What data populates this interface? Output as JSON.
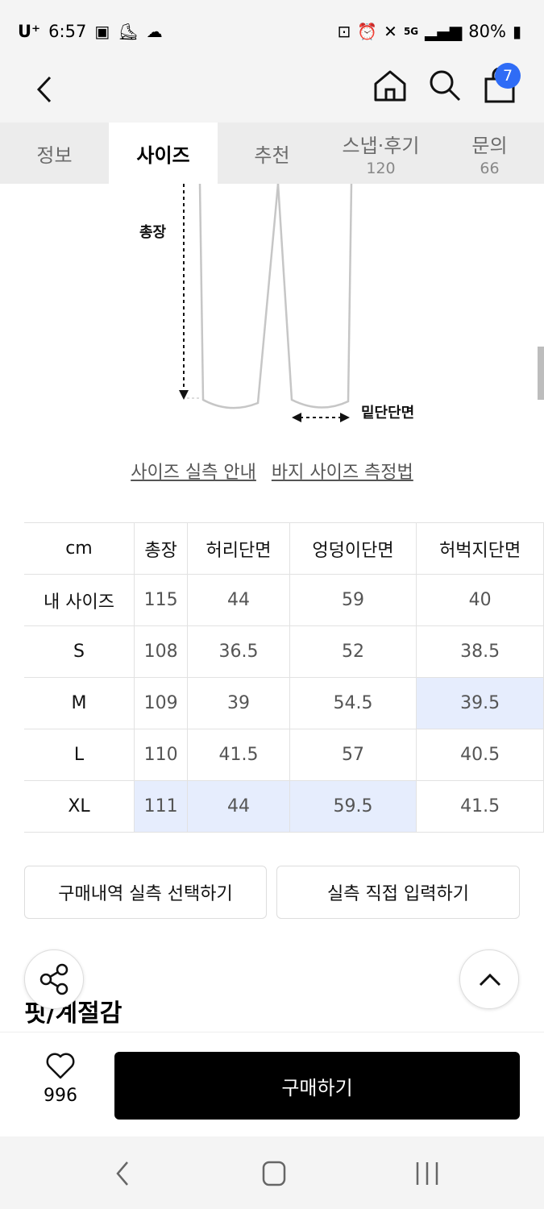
{
  "status": {
    "carrier": "U⁺",
    "time": "6:57",
    "battery": "80%",
    "network": "5G"
  },
  "header": {
    "cart_count": "7"
  },
  "tabs": [
    {
      "label": "정보",
      "count": ""
    },
    {
      "label": "사이즈",
      "count": ""
    },
    {
      "label": "추천",
      "count": ""
    },
    {
      "label": "스냅·후기",
      "count": "120"
    },
    {
      "label": "문의",
      "count": "66"
    }
  ],
  "diagram": {
    "label_length": "총장",
    "label_hem": "밑단단면"
  },
  "links": {
    "guide": "사이즈 실측 안내",
    "measure": "바지 사이즈 측정법"
  },
  "size_table": {
    "headers": [
      "cm",
      "총장",
      "허리단면",
      "엉덩이단면",
      "허벅지단면"
    ],
    "rows": [
      {
        "label": "내 사이즈",
        "values": [
          "115",
          "44",
          "59",
          "40"
        ]
      },
      {
        "label": "S",
        "values": [
          "108",
          "36.5",
          "52",
          "38.5"
        ]
      },
      {
        "label": "M",
        "values": [
          "109",
          "39",
          "54.5",
          "39.5"
        ]
      },
      {
        "label": "L",
        "values": [
          "110",
          "41.5",
          "57",
          "40.5"
        ]
      },
      {
        "label": "XL",
        "values": [
          "111",
          "44",
          "59.5",
          "41.5"
        ]
      }
    ]
  },
  "buttons": {
    "purchase_history": "구매내역 실측 선택하기",
    "direct_input": "실측 직접 입력하기",
    "buy": "구매하기"
  },
  "section": {
    "title": "핏/계절감"
  },
  "like": {
    "count": "996"
  }
}
